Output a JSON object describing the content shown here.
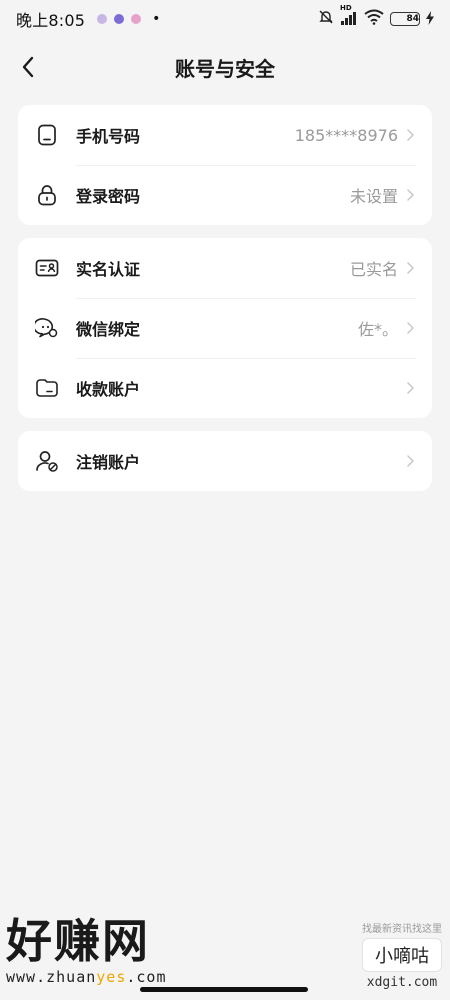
{
  "status_bar": {
    "time": "晚上8:05",
    "network_badge": "HD",
    "battery_level": "84",
    "battery_fraction": 0.84
  },
  "header": {
    "back_icon": "chevron-left-icon",
    "title": "账号与安全"
  },
  "groups": [
    {
      "items": [
        {
          "icon": "phone-icon",
          "label": "手机号码",
          "value": "185****8976"
        },
        {
          "icon": "lock-icon",
          "label": "登录密码",
          "value": "未设置"
        }
      ]
    },
    {
      "items": [
        {
          "icon": "id-card-icon",
          "label": "实名认证",
          "value": "已实名"
        },
        {
          "icon": "wechat-icon",
          "label": "微信绑定",
          "value": "佐*。"
        },
        {
          "icon": "wallet-icon",
          "label": "收款账户",
          "value": ""
        }
      ]
    },
    {
      "items": [
        {
          "icon": "user-cancel-icon",
          "label": "注销账户",
          "value": ""
        }
      ]
    }
  ],
  "watermarks": {
    "left_title": "好赚网",
    "left_url_a": "www.zhuan",
    "left_url_b": "yes",
    "left_url_c": ".com",
    "right_top": "找最新资讯找这里",
    "right_name": "小嘀咕",
    "right_url": "xdgit.com"
  },
  "colors": {
    "background": "#f4f4f4",
    "card": "#ffffff",
    "value_text": "#9a9a9a",
    "battery": "#7ed957",
    "watermark_accent": "#f0a800"
  }
}
